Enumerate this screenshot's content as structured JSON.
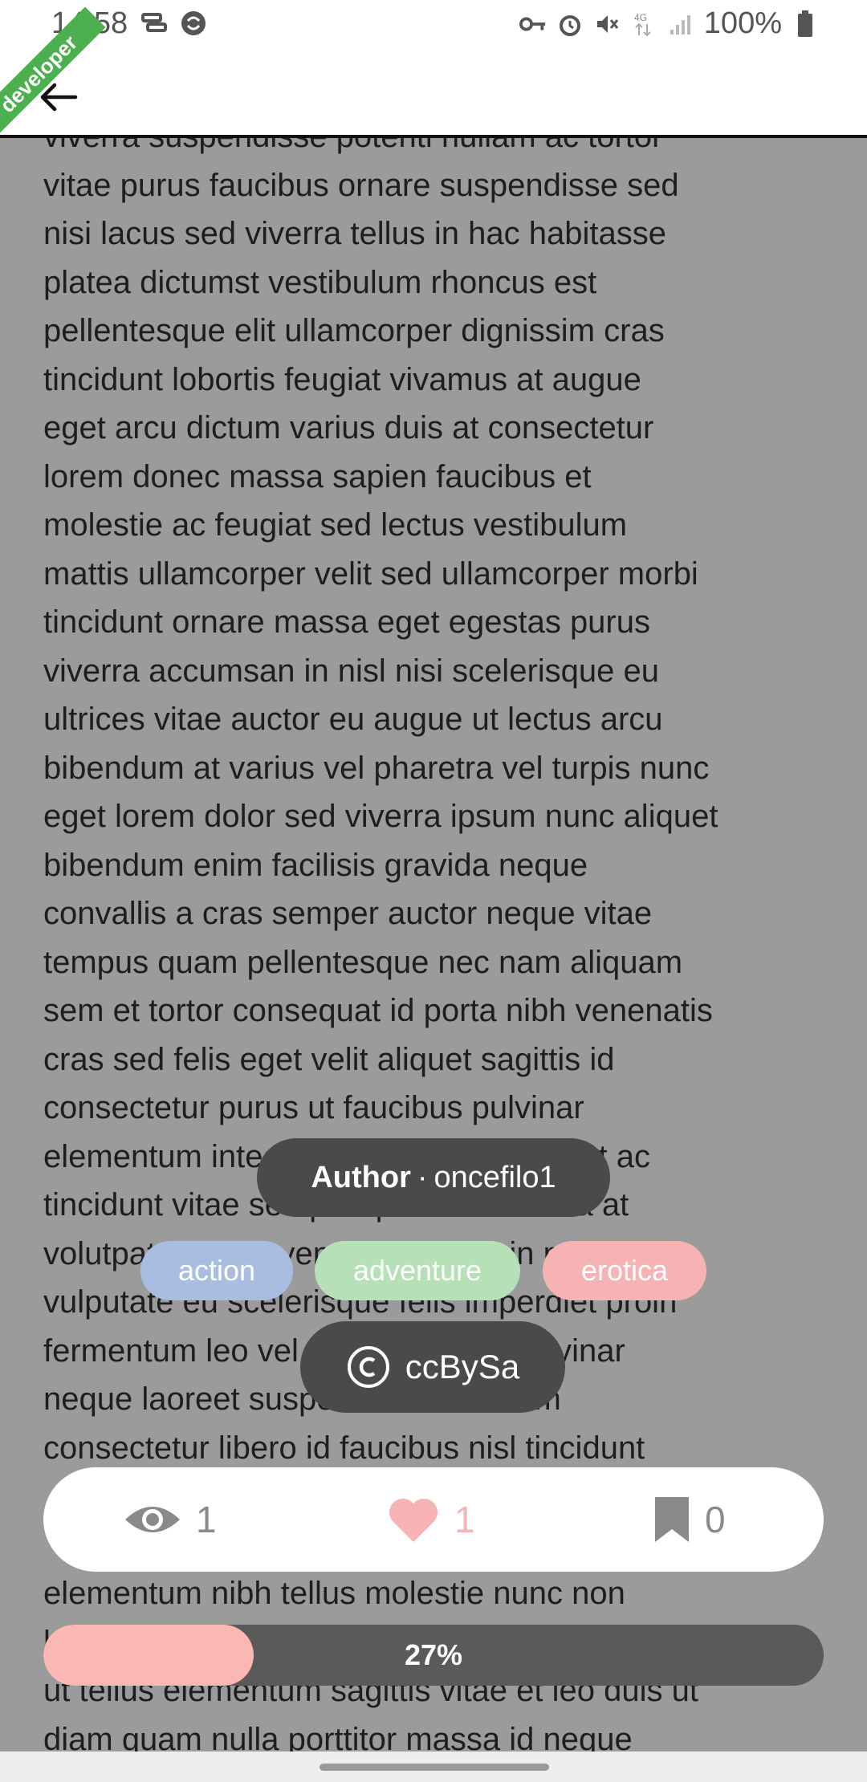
{
  "status_bar": {
    "time": "14:58",
    "battery": "100%",
    "icons_left": [
      "cast-icon",
      "sync-icon"
    ],
    "icons_right": [
      "key-icon",
      "alarm-icon",
      "mute-icon",
      "4g-icon",
      "signal-icon",
      "battery-icon"
    ]
  },
  "app_bar": {
    "back_icon": "arrow-left-icon",
    "ribbon_text": "developer"
  },
  "story": {
    "text": "viverra suspendisse potenti nullam ac tortor\nvitae purus faucibus ornare suspendisse sed\nnisi lacus sed viverra tellus in hac habitasse\nplatea dictumst vestibulum rhoncus est\npellentesque elit ullamcorper dignissim cras\ntincidunt lobortis feugiat vivamus at augue\neget arcu dictum varius duis at consectetur\nlorem donec massa sapien faucibus et\nmolestie ac feugiat sed lectus vestibulum\nmattis ullamcorper velit sed ullamcorper morbi\ntincidunt ornare massa eget egestas purus\nviverra accumsan in nisl nisi scelerisque eu\nultrices vitae auctor eu augue ut lectus arcu\nbibendum at varius vel pharetra vel turpis nunc\neget lorem dolor sed viverra ipsum nunc aliquet\nbibendum enim facilisis gravida neque\nconvallis a cras semper auctor neque vitae\ntempus quam pellentesque nec nam aliquam\nsem et tortor consequat id porta nibh venenatis\ncras sed felis eget velit aliquet sagittis id\nconsectetur purus ut faucibus pulvinar\nelementum integer enim neque volutpat ac\ntincidunt vitae semper quis lectus nulla at\nvolutpat diam ut venenatis tellus in metus\nvulputate eu scelerisque felis imperdiet proin\nfermentum leo vel orci porta non pulvinar\nneque laoreet suspendisse interdum\nconsectetur libero id faucibus nisl tincidunt\n\n\nelementum nibh tellus molestie nunc non\nblandit massa enim nec dui nunc mattis enim\nut tellus elementum sagittis vitae et leo duis ut\ndiam quam nulla porttitor massa id neque"
  },
  "author": {
    "label": "Author",
    "separator": "·",
    "name": "oncefilo1"
  },
  "tags": [
    {
      "label": "action",
      "color": "#a9bde0"
    },
    {
      "label": "adventure",
      "color": "#b6e0b6"
    },
    {
      "label": "erotica",
      "color": "#f7b3b3"
    }
  ],
  "license": {
    "icon": "copyright-icon",
    "label": "ccBySa"
  },
  "stats": {
    "views": "1",
    "likes": "1",
    "saves": "0",
    "views_icon": "eye-icon",
    "likes_icon": "heart-icon",
    "saves_icon": "bookmark-icon"
  },
  "progress": {
    "label": "27%",
    "fraction": 0.27
  },
  "colors": {
    "accent_pink": "#fbb8b3",
    "overlay_dark": "#4a4a4a",
    "dim_background": "#9b9b9b"
  }
}
